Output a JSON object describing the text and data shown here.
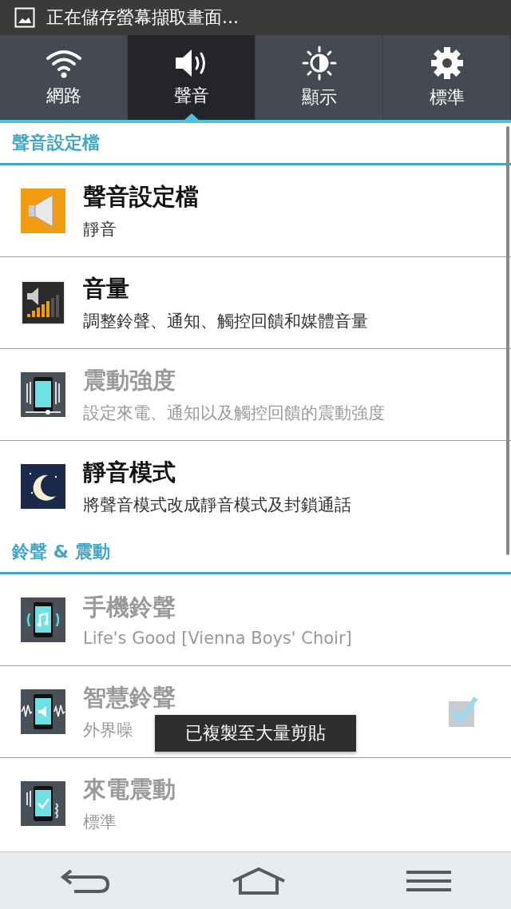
{
  "notification": {
    "text": "正在儲存螢幕擷取畫面..."
  },
  "tabs": [
    {
      "label": "網路",
      "selected": false
    },
    {
      "label": "聲音",
      "selected": true
    },
    {
      "label": "顯示",
      "selected": false
    },
    {
      "label": "標準",
      "selected": false
    }
  ],
  "sections": [
    {
      "header": "聲音設定檔",
      "items": [
        {
          "title": "聲音設定檔",
          "subtitle": "靜音",
          "disabled": false,
          "kind": "plain"
        },
        {
          "title": "音量",
          "subtitle": "調整鈴聲、通知、觸控回饋和媒體音量",
          "disabled": false,
          "kind": "plain"
        },
        {
          "title": "震動強度",
          "subtitle": "設定來電、通知以及觸控回饋的震動強度",
          "disabled": true,
          "kind": "plain"
        },
        {
          "title": "靜音模式",
          "subtitle": "將聲音模式改成靜音模式及封鎖通話",
          "disabled": false,
          "kind": "plain"
        }
      ]
    },
    {
      "header": "鈴聲 & 震動",
      "items": [
        {
          "title": "手機鈴聲",
          "subtitle": "Life's Good [Vienna Boys' Choir]",
          "disabled": true,
          "kind": "plain"
        },
        {
          "title": "智慧鈴聲",
          "subtitle": "外界噪",
          "disabled": true,
          "kind": "checkbox",
          "checked": true
        },
        {
          "title": "來電震動",
          "subtitle": "標準",
          "disabled": true,
          "kind": "plain"
        }
      ]
    }
  ],
  "toast": {
    "text": "已複製至大量剪貼"
  }
}
